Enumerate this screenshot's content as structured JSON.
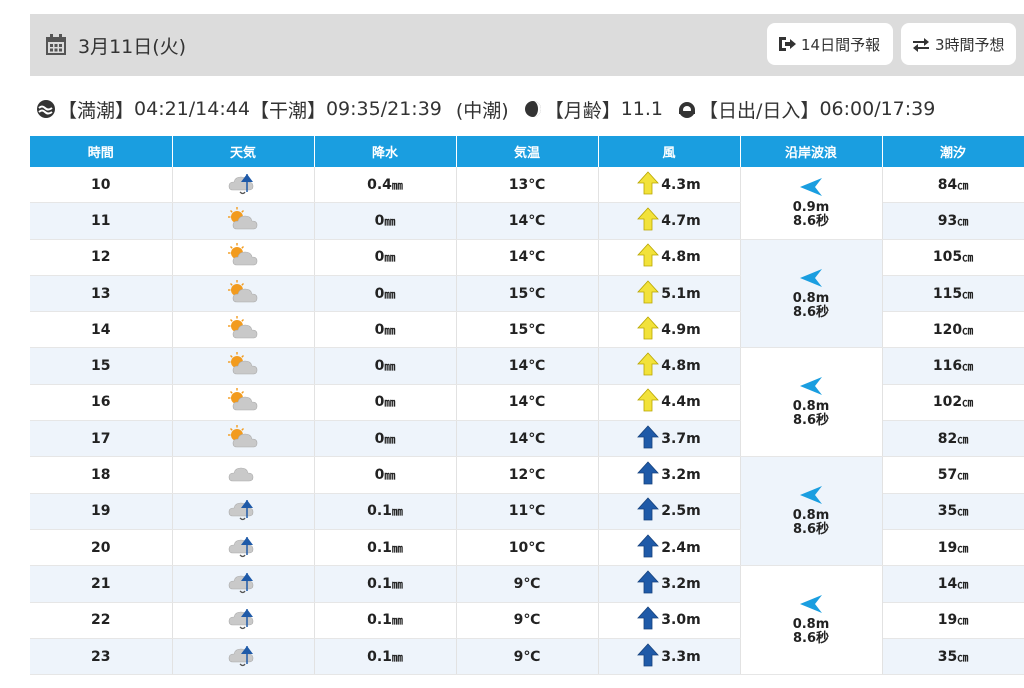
{
  "header": {
    "date": "3月11日(火)",
    "btn_14day": "14日間予報",
    "btn_3hour": "3時間予想"
  },
  "tide_info": {
    "high_label": "【満潮】",
    "high_value": "04:21/14:44",
    "low_label": "【干潮】",
    "low_value": "09:35/21:39",
    "tide_type": "(中潮)",
    "moon_label": "【月齢】",
    "moon_value": "11.1",
    "sun_label": "【日出/日入】",
    "sun_value": "06:00/17:39"
  },
  "table": {
    "columns": [
      "時間",
      "天気",
      "降水",
      "気温",
      "風",
      "沿岸波浪",
      "潮汐"
    ],
    "rows": [
      {
        "hour": "10",
        "weather": "cloud-rain-icon",
        "precip": "0.4",
        "temp": "13℃",
        "wind_dir": "S",
        "wind": "4.3m",
        "tide": "84"
      },
      {
        "hour": "11",
        "weather": "sun-cloud-icon",
        "precip": "0",
        "temp": "14℃",
        "wind_dir": "S",
        "wind": "4.7m",
        "tide": "93"
      },
      {
        "hour": "12",
        "weather": "sun-cloud-icon",
        "precip": "0",
        "temp": "14℃",
        "wind_dir": "S",
        "wind": "4.8m",
        "tide": "105"
      },
      {
        "hour": "13",
        "weather": "sun-cloud-icon",
        "precip": "0",
        "temp": "15℃",
        "wind_dir": "S",
        "wind": "5.1m",
        "tide": "115"
      },
      {
        "hour": "14",
        "weather": "sun-cloud-icon",
        "precip": "0",
        "temp": "15℃",
        "wind_dir": "S",
        "wind": "4.9m",
        "tide": "120"
      },
      {
        "hour": "15",
        "weather": "sun-cloud-icon",
        "precip": "0",
        "temp": "14℃",
        "wind_dir": "S",
        "wind": "4.8m",
        "tide": "116"
      },
      {
        "hour": "16",
        "weather": "sun-cloud-icon",
        "precip": "0",
        "temp": "14℃",
        "wind_dir": "S",
        "wind": "4.4m",
        "tide": "102"
      },
      {
        "hour": "17",
        "weather": "sun-cloud-icon",
        "precip": "0",
        "temp": "14℃",
        "wind_dir": "S-strong",
        "wind": "3.7m",
        "tide": "82"
      },
      {
        "hour": "18",
        "weather": "cloud-icon",
        "precip": "0",
        "temp": "12℃",
        "wind_dir": "S-strong",
        "wind": "3.2m",
        "tide": "57"
      },
      {
        "hour": "19",
        "weather": "cloud-rain-icon",
        "precip": "0.1",
        "temp": "11℃",
        "wind_dir": "S-strong",
        "wind": "2.5m",
        "tide": "35"
      },
      {
        "hour": "20",
        "weather": "cloud-rain-icon",
        "precip": "0.1",
        "temp": "10℃",
        "wind_dir": "S-strong",
        "wind": "2.4m",
        "tide": "19"
      },
      {
        "hour": "21",
        "weather": "cloud-rain-icon",
        "precip": "0.1",
        "temp": "9℃",
        "wind_dir": "S-strong",
        "wind": "3.2m",
        "tide": "14"
      },
      {
        "hour": "22",
        "weather": "cloud-rain-icon",
        "precip": "0.1",
        "temp": "9℃",
        "wind_dir": "S-strong",
        "wind": "3.0m",
        "tide": "19"
      },
      {
        "hour": "23",
        "weather": "cloud-rain-icon",
        "precip": "0.1",
        "temp": "9℃",
        "wind_dir": "S-strong",
        "wind": "3.3m",
        "tide": "35"
      }
    ],
    "waves": [
      {
        "height": "0.9m",
        "period": "8.6秒"
      },
      {
        "height": "0.8m",
        "period": "8.6秒"
      },
      {
        "height": "0.8m",
        "period": "8.6秒"
      },
      {
        "height": "0.8m",
        "period": "8.6秒"
      },
      {
        "height": "0.8m",
        "period": "8.6秒"
      }
    ],
    "precip_unit": "㎜",
    "tide_unit": "㎝"
  },
  "colors": {
    "header_bg": "#dcdcdc",
    "table_header": "#1a9ee0",
    "row_alt": "#eef4fb",
    "wind_weak": "#f2e23a",
    "wind_strong": "#1f5aa8",
    "wave_arrow": "#1a9ee0"
  }
}
